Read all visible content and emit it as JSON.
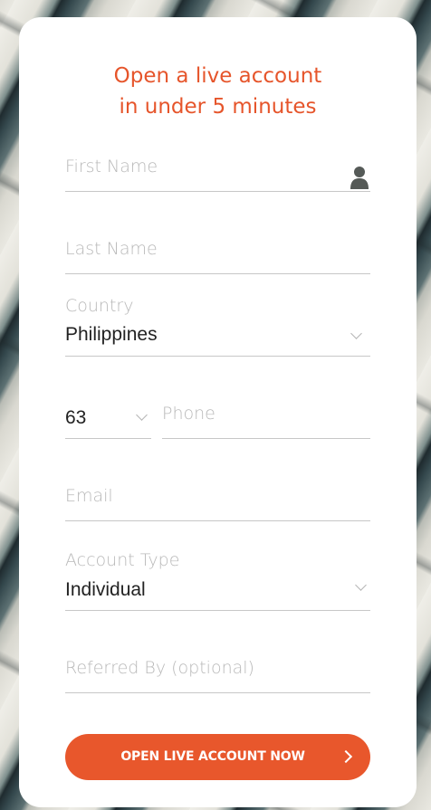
{
  "form": {
    "headline_line1": "Open a live account",
    "headline_line2": "in under 5 minutes",
    "first_name": {
      "placeholder": "First Name",
      "icon": "person-icon"
    },
    "last_name": {
      "placeholder": "Last Name"
    },
    "country": {
      "label": "Country",
      "value": "Philippines",
      "icon": "chevron-down-icon"
    },
    "phone": {
      "code": "63",
      "placeholder": "Phone",
      "icon": "chevron-down-icon"
    },
    "email": {
      "placeholder": "Email"
    },
    "account_type": {
      "label": "Account Type",
      "value": "Individual",
      "icon": "chevron-down-icon"
    },
    "referred_by": {
      "placeholder": "Referred By (optional)"
    },
    "submit_label": "OPEN LIVE ACCOUNT NOW",
    "submit_icon": "chevron-right-icon"
  },
  "colors": {
    "accent": "#e8572c",
    "headline": "#e6552b",
    "placeholder": "#b9b9b9",
    "underline": "#c7c7c7",
    "value_text": "#222222",
    "card": "#ffffff"
  }
}
